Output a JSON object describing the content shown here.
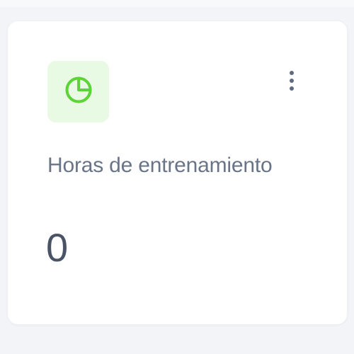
{
  "card": {
    "icon": "pie-chart-icon",
    "menu_icon": "more-vertical-icon",
    "label": "Horas de entrenamiento",
    "value": "0"
  },
  "colors": {
    "icon_accent": "#5cd337",
    "icon_tile_bg": "#e8fae3",
    "label_text": "#697488",
    "value_text": "#4a5466",
    "menu_dots": "#5f6b80"
  }
}
